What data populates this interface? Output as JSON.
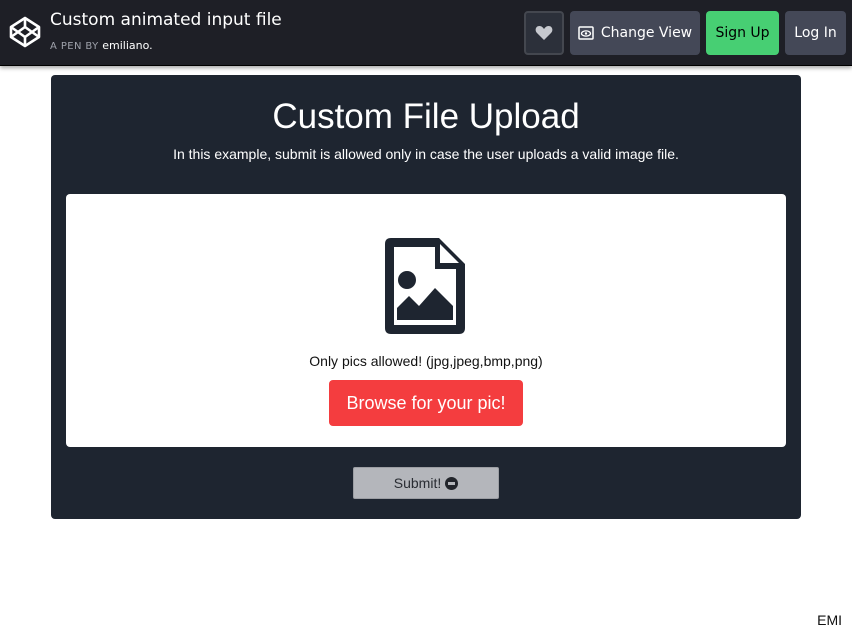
{
  "header": {
    "title": "Custom animated input file",
    "byline_prefix": "A PEN BY",
    "author": "emiliano.",
    "buttons": {
      "heart_icon": "heart-icon",
      "change_view": "Change View",
      "sign_up": "Sign Up",
      "log_in": "Log In"
    }
  },
  "panel": {
    "title": "Custom File Upload",
    "subtitle": "In this example, submit is allowed only in case the user uploads a valid image file.",
    "dropzone": {
      "icon": "image-file-icon",
      "hint": "Only pics allowed! (jpg,jpeg,bmp,png)",
      "browse_label": "Browse for your pic!"
    },
    "submit_label": "Submit!"
  },
  "footer_tag": "EMI",
  "colors": {
    "header_bg": "#1e1f26",
    "panel_bg": "#1e2530",
    "browse_bg": "#f43d3f",
    "signup_bg": "#47cf73",
    "submit_bg": "#b4b6bb"
  }
}
